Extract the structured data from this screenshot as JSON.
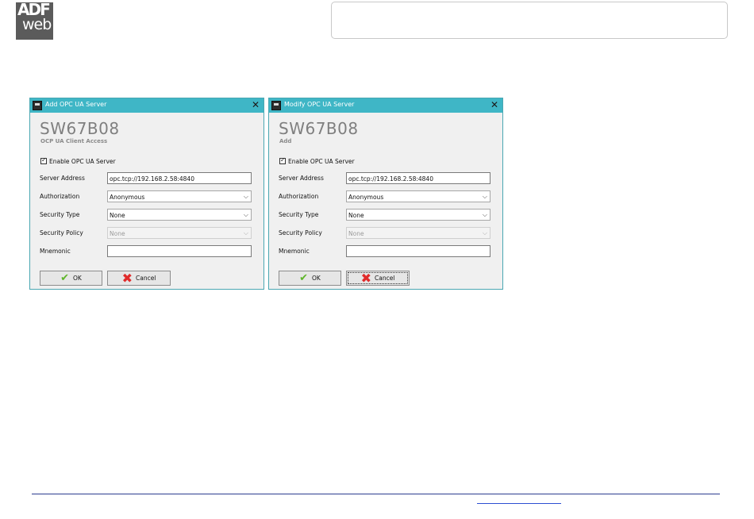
{
  "header": {
    "logo_top": "ADF",
    "logo_bottom": "web"
  },
  "dialogs": [
    {
      "title": "Add OPC UA Server",
      "product": "SW67B08",
      "subtitle": "OCP UA Client Access",
      "enable_label": "Enable OPC UA Server",
      "enable_checked": true,
      "server_address_label": "Server Address",
      "server_address_value": "opc.tcp://192.168.2.58:4840",
      "authorization_label": "Authorization",
      "authorization_value": "Anonymous",
      "security_type_label": "Security Type",
      "security_type_value": "None",
      "security_policy_label": "Security Policy",
      "security_policy_value": "None",
      "mnemonic_label": "Mnemonic",
      "mnemonic_value": "",
      "ok_label": "OK",
      "cancel_label": "Cancel"
    },
    {
      "title": "Modify OPC UA Server",
      "product": "SW67B08",
      "subtitle": "Add",
      "enable_label": "Enable OPC UA Server",
      "enable_checked": true,
      "server_address_label": "Server Address",
      "server_address_value": "opc.tcp://192.168.2.58:4840",
      "authorization_label": "Authorization",
      "authorization_value": "Anonymous",
      "security_type_label": "Security Type",
      "security_type_value": "None",
      "security_policy_label": "Security Policy",
      "security_policy_value": "None",
      "mnemonic_label": "Mnemonic",
      "mnemonic_value": "",
      "ok_label": "OK",
      "cancel_label": "Cancel"
    }
  ],
  "colors": {
    "titlebar": "#3fb6c6",
    "dialog_bg": "#f0f0f0",
    "ok_icon": "#5fb52a",
    "cancel_icon": "#e02b2b",
    "footer_line": "#2b3b8f"
  },
  "icons": {
    "app": "app-icon",
    "close": "close-icon",
    "ok": "checkmark-icon",
    "cancel": "cross-icon",
    "dropdown": "chevron-down-icon"
  }
}
